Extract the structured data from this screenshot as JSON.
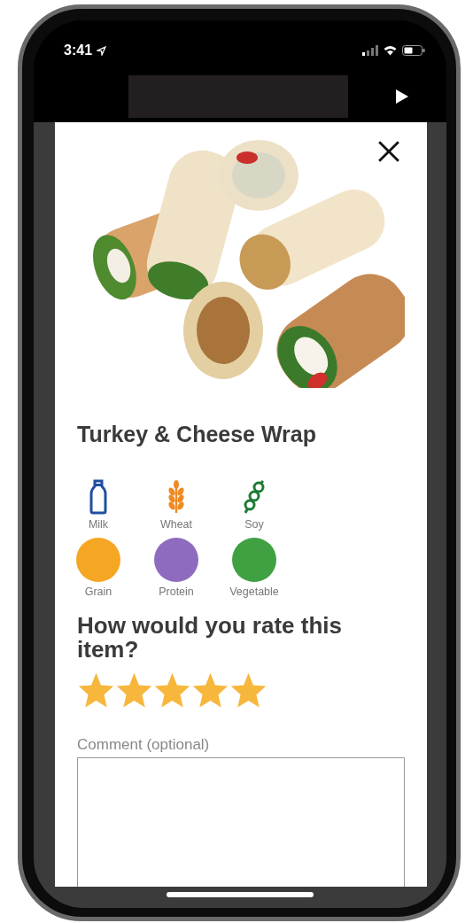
{
  "status_bar": {
    "time": "3:41"
  },
  "item": {
    "title": "Turkey & Cheese Wrap",
    "allergens": [
      {
        "label": "Milk",
        "kind": "milk",
        "color": "#1f4fa0"
      },
      {
        "label": "Wheat",
        "kind": "wheat",
        "color": "#f08a24"
      },
      {
        "label": "Soy",
        "kind": "soy",
        "color": "#1e7a35"
      }
    ],
    "food_groups": [
      {
        "label": "Grain",
        "color": "#f5a623"
      },
      {
        "label": "Protein",
        "color": "#8e6bbf"
      },
      {
        "label": "Vegetable",
        "color": "#3fa142"
      }
    ]
  },
  "rating": {
    "question": "How would you rate this item?",
    "stars": 5
  },
  "comment": {
    "label": "Comment (optional)"
  }
}
